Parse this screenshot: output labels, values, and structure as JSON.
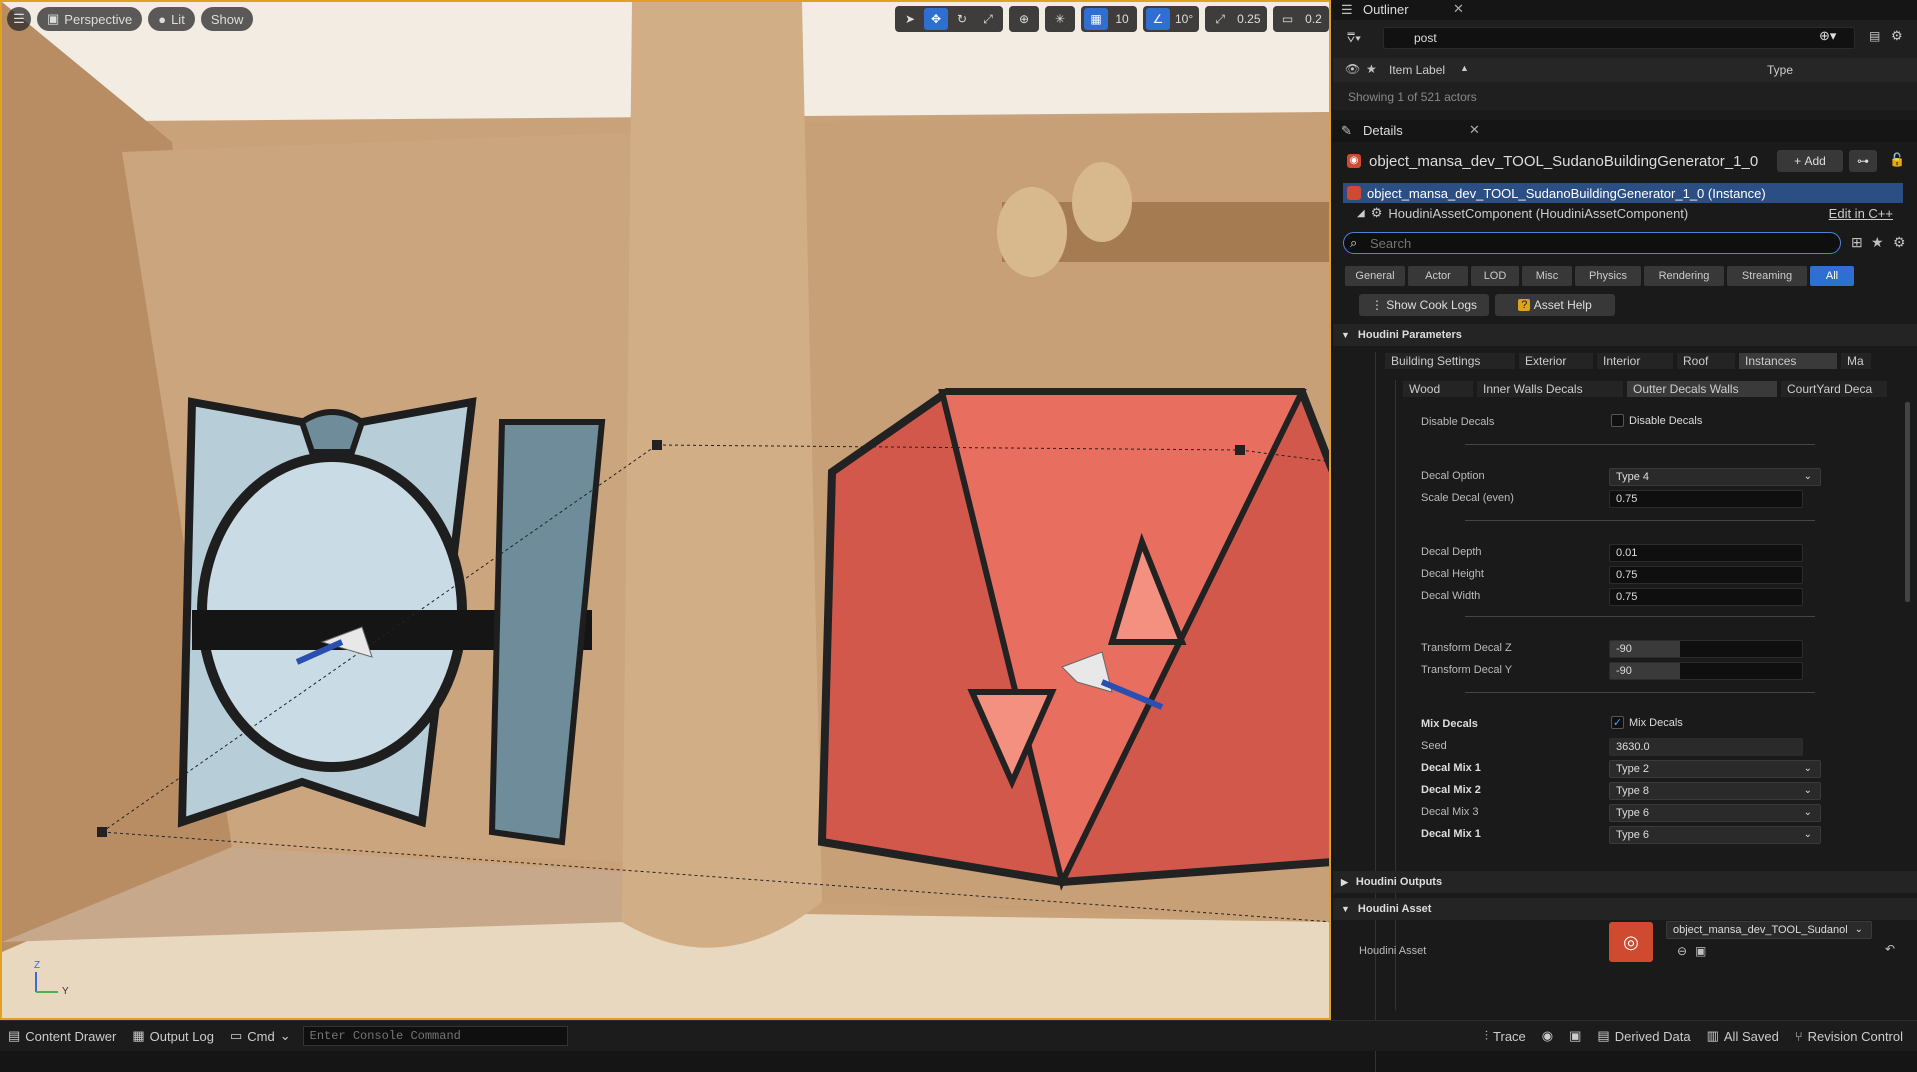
{
  "viewport": {
    "menu_icon": "hamburger-icon",
    "view_mode": "Perspective",
    "lit_mode": "Lit",
    "show_label": "Show",
    "grid_snap": "10",
    "rot_snap": "10°",
    "scale_snap": "0.25",
    "camera_speed": "0.2",
    "axis_z": "Z",
    "axis_y": "Y"
  },
  "outliner": {
    "title": "Outliner",
    "search_value": "post",
    "col_label": "Item Label",
    "col_type": "Type",
    "status": "Showing 1 of 521 actors"
  },
  "details": {
    "title": "Details",
    "object_name": "object_mansa_dev_TOOL_SudanoBuildingGenerator_1_0",
    "add_label": "Add",
    "instance_row": "object_mansa_dev_TOOL_SudanoBuildingGenerator_1_0 (Instance)",
    "component_row": "HoudiniAssetComponent (HoudiniAssetComponent)",
    "edit_cpp": "Edit in C++",
    "search_placeholder": "Search",
    "categories": [
      "General",
      "Actor",
      "LOD",
      "Misc",
      "Physics",
      "Rendering",
      "Streaming",
      "All"
    ],
    "show_cook_logs": "Show Cook Logs",
    "asset_help": "Asset Help",
    "houdini_parameters": "Houdini Parameters",
    "param_tabs": [
      "Building Settings",
      "Exterior",
      "Interior",
      "Roof",
      "Instances",
      "Ma"
    ],
    "sub_tabs": [
      "Wood",
      "Inner Walls Decals",
      "Outter Decals Walls",
      "CourtYard Deca"
    ],
    "disable_decals_label": "Disable Decals",
    "disable_decals_check": "Disable Decals",
    "decal_option_label": "Decal Option",
    "decal_option_value": "Type 4",
    "scale_decal_label": "Scale Decal (even)",
    "scale_decal_value": "0.75",
    "decal_depth_label": "Decal Depth",
    "decal_depth_value": "0.01",
    "decal_height_label": "Decal Height",
    "decal_height_value": "0.75",
    "decal_width_label": "Decal Width",
    "decal_width_value": "0.75",
    "transform_z_label": "Transform Decal Z",
    "transform_z_value": "-90",
    "transform_y_label": "Transform Decal Y",
    "transform_y_value": "-90",
    "mix_decals_label": "Mix Decals",
    "mix_decals_check": "Mix Decals",
    "seed_label": "Seed",
    "seed_value": "3630.0",
    "mix1_label": "Decal Mix 1",
    "mix1_value": "Type 2",
    "mix2_label": "Decal Mix 2",
    "mix2_value": "Type 8",
    "mix3_label": "Decal Mix 3",
    "mix3_value": "Type 6",
    "mix4_label": "Decal Mix 1",
    "mix4_value": "Type 6",
    "houdini_outputs": "Houdini Outputs",
    "houdini_asset_section": "Houdini Asset",
    "houdini_asset_label": "Houdini Asset",
    "houdini_asset_value": "object_mansa_dev_TOOL_Sudanol"
  },
  "bottombar": {
    "content_drawer": "Content Drawer",
    "output_log": "Output Log",
    "cmd": "Cmd",
    "console_placeholder": "Enter Console Command",
    "trace": "Trace",
    "derived_data": "Derived Data",
    "all_saved": "All Saved",
    "revision_control": "Revision Control"
  },
  "colors": {
    "accent": "#2e6fd1",
    "selection_outline": "#e0a020"
  }
}
